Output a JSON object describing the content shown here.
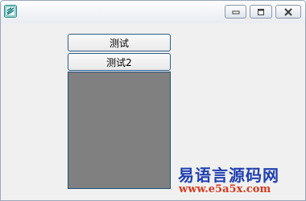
{
  "window": {
    "icon": "app-icon",
    "controls": {
      "minimize_icon": "minimize-icon",
      "maximize_icon": "maximize-icon",
      "close_icon": "close-icon"
    }
  },
  "buttons": {
    "button1_label": "测试",
    "button2_label": "测试2"
  },
  "panel": {
    "color": "#808080"
  },
  "watermark": {
    "title": "易语言源码网",
    "url": "www.e5a5x.com"
  },
  "colors": {
    "watermark_title": "#1f3fb0",
    "watermark_url": "#d23a1e",
    "button_border": "#2d5c86"
  }
}
